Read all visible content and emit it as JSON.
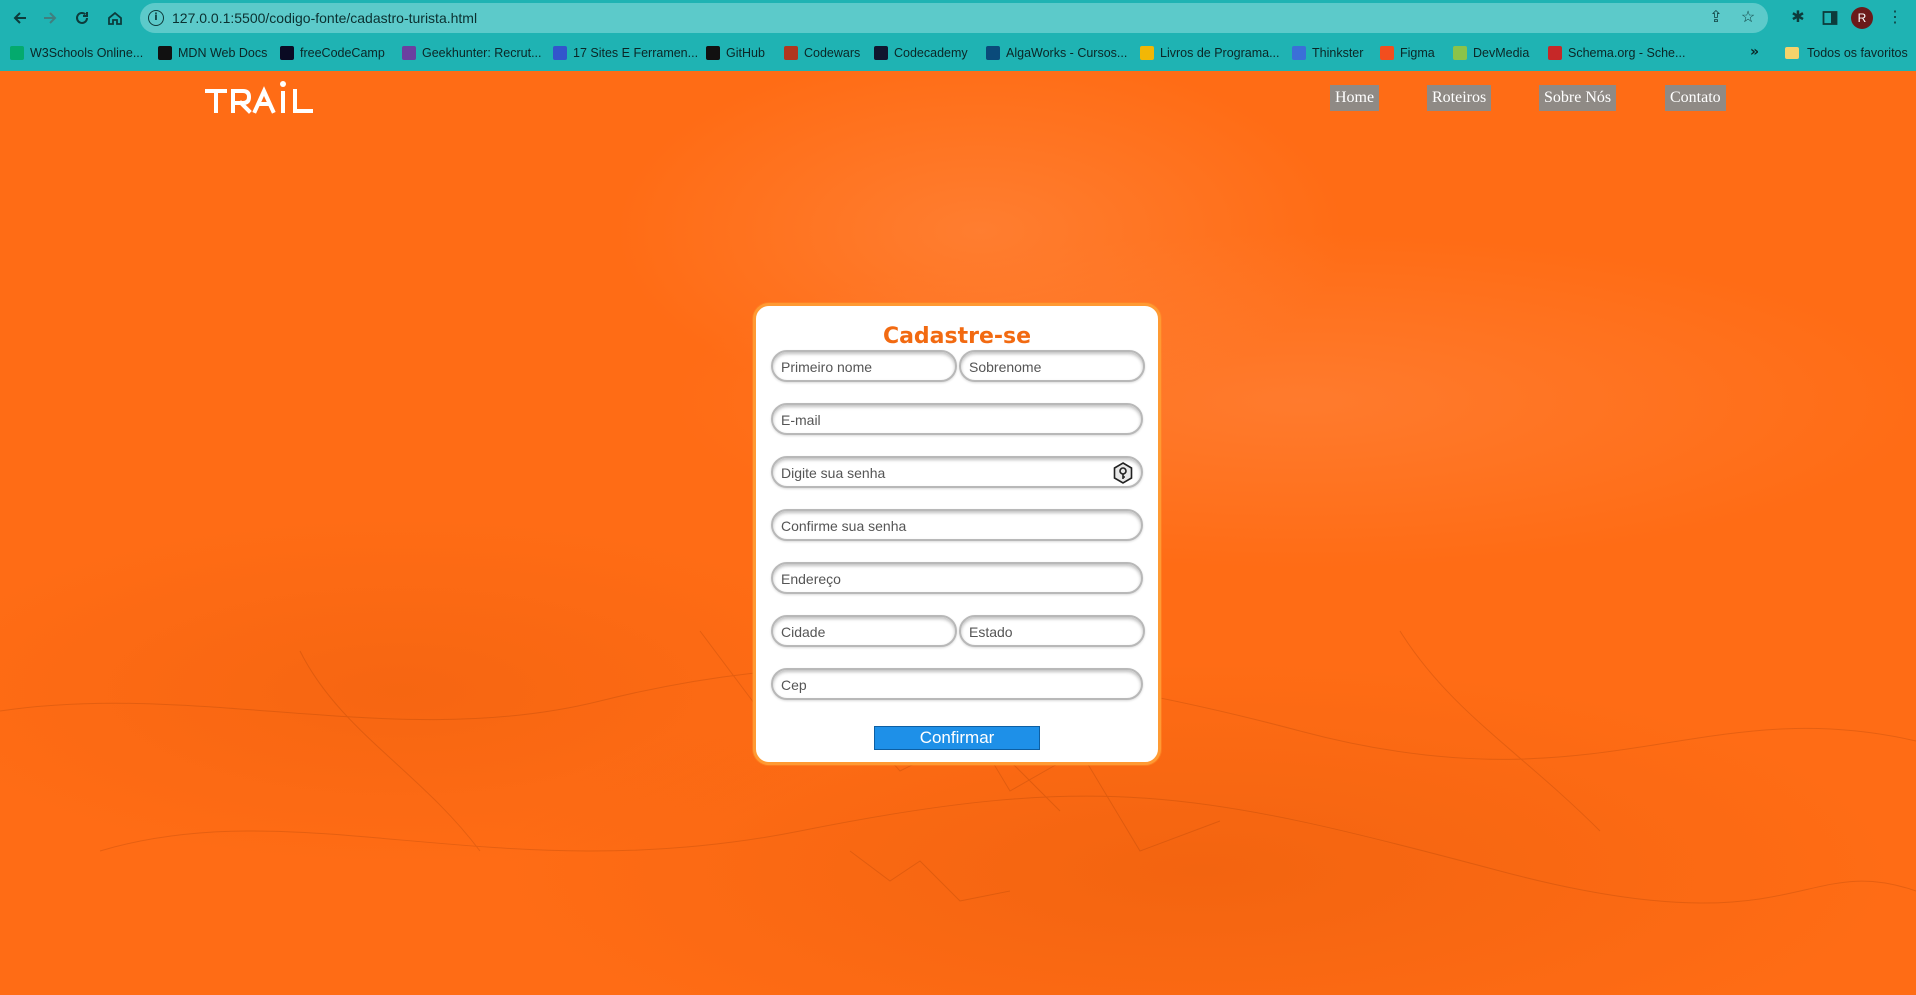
{
  "browser": {
    "url": "127.0.0.1:5500/codigo-fonte/cadastro-turista.html",
    "profile_initial": "R",
    "bookmarks": [
      {
        "label": "W3Schools Online...",
        "icon": "w3schools-icon",
        "color": "#04aa6d"
      },
      {
        "label": "MDN Web Docs",
        "icon": "mdn-icon",
        "color": "#111111"
      },
      {
        "label": "freeCodeCamp",
        "icon": "freecodecamp-icon",
        "color": "#0a0a23"
      },
      {
        "label": "Geekhunter: Recrut...",
        "icon": "geekhunter-icon",
        "color": "#6b3fa0"
      },
      {
        "label": "17 Sites E Ferramen...",
        "icon": "shield-icon",
        "color": "#3355cc"
      },
      {
        "label": "GitHub",
        "icon": "github-icon",
        "color": "#111111"
      },
      {
        "label": "Codewars",
        "icon": "codewars-icon",
        "color": "#b1361e"
      },
      {
        "label": "Codecademy",
        "icon": "codecademy-icon",
        "color": "#10162f"
      },
      {
        "label": "AlgaWorks - Cursos...",
        "icon": "algaworks-icon",
        "color": "#0a4a7a"
      },
      {
        "label": "Livros de Programa...",
        "icon": "book-icon",
        "color": "#f2b705"
      },
      {
        "label": "Thinkster",
        "icon": "thinkster-icon",
        "color": "#3b6fd8"
      },
      {
        "label": "Figma",
        "icon": "figma-icon",
        "color": "#f24e1e"
      },
      {
        "label": "DevMedia",
        "icon": "devmedia-icon",
        "color": "#8bc34a"
      },
      {
        "label": "Schema.org - Sche...",
        "icon": "schema-icon",
        "color": "#c62828"
      }
    ],
    "more_bookmarks": "»",
    "all_favorites": "Todos os favoritos"
  },
  "site": {
    "logo": "TRAIL",
    "nav": [
      "Home",
      "Roteiros",
      "Sobre Nós",
      "Contato"
    ]
  },
  "form": {
    "title": "Cadastre-se",
    "first_name_placeholder": "Primeiro nome",
    "last_name_placeholder": "Sobrenome",
    "email_placeholder": "E-mail",
    "password_placeholder": "Digite sua senha",
    "confirm_password_placeholder": "Confirme sua senha",
    "address_placeholder": "Endereço",
    "city_placeholder": "Cidade",
    "state_placeholder": "Estado",
    "zip_placeholder": "Cep",
    "submit_label": "Confirmar"
  },
  "colors": {
    "chrome": "#1fb3b3",
    "page_background": "#ff6c15",
    "title": "#f26a11",
    "button": "#1e90e8",
    "nav_button": "#8f8a85"
  }
}
